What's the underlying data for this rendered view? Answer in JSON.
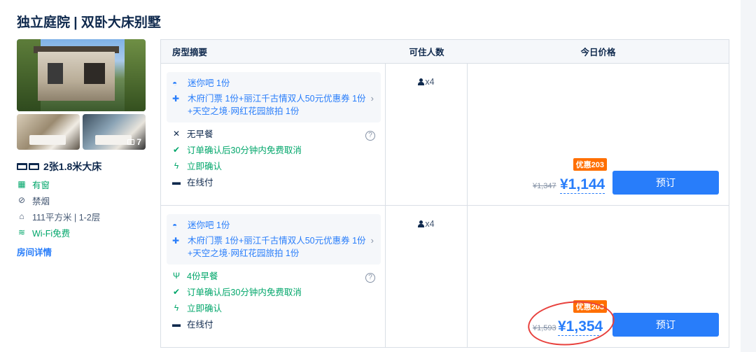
{
  "room": {
    "title": "独立庭院 | 双卧大床别墅",
    "photo_count": "7",
    "bed": "2张1.8米大床",
    "attributes": [
      {
        "icon": "window-icon",
        "label": "有窗",
        "tone": "green"
      },
      {
        "icon": "no-smoking-icon",
        "label": "禁烟",
        "tone": "gray"
      },
      {
        "icon": "area-icon",
        "label": "111平方米 | 1-2层",
        "tone": "gray"
      },
      {
        "icon": "wifi-icon",
        "label": "Wi-Fi免费",
        "tone": "green"
      }
    ],
    "detail_link": "房间详情"
  },
  "table": {
    "headers": [
      "房型摘要",
      "可住人数",
      "今日价格"
    ],
    "rows": [
      {
        "bundle": [
          "迷你吧 1份",
          "木府门票 1份+丽江千古情双人50元优惠券 1份+天空之境·网红花园旅拍 1份"
        ],
        "meal": "无早餐",
        "cancel": "订单确认后30分钟内免费取消",
        "confirm": "立即确认",
        "payment": "在线付",
        "occupancy": "x4",
        "discount": "优惠203",
        "old_price": "¥1,347",
        "price": "¥1,144",
        "book": "预订"
      },
      {
        "bundle": [
          "迷你吧 1份",
          "木府门票 1份+丽江千古情双人50元优惠券 1份+天空之境·网红花园旅拍 1份"
        ],
        "meal": "4份早餐",
        "cancel": "订单确认后30分钟内免费取消",
        "confirm": "立即确认",
        "payment": "在线付",
        "occupancy": "x4",
        "discount": "优惠203",
        "old_price": "¥1,593",
        "price": "¥1,354",
        "book": "预订"
      }
    ]
  },
  "colors": {
    "accent": "#287dfa",
    "green": "#00a66a",
    "discount": "#ff6f00",
    "annotation": "#e8413d"
  }
}
